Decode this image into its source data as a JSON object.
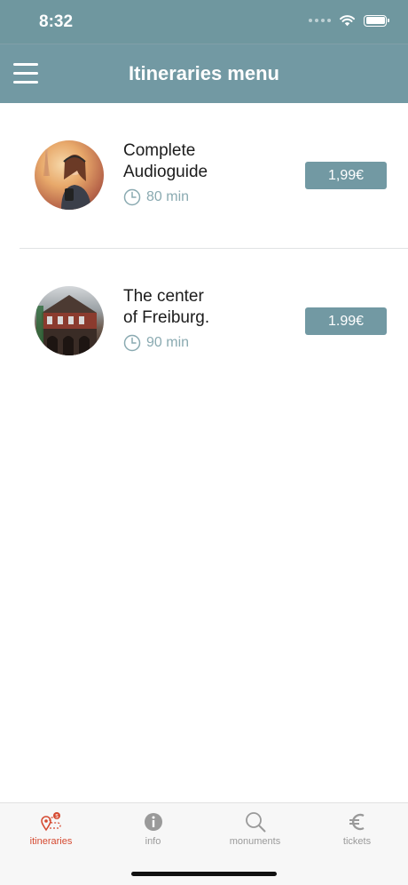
{
  "status_bar": {
    "time": "8:32"
  },
  "header": {
    "title": "Itineraries menu",
    "menu_icon": "hamburger-icon"
  },
  "itineraries": [
    {
      "title": "Complete\nAudioguide",
      "duration": "80 min",
      "price": "1,99€"
    },
    {
      "title": "The center\nof Freiburg.",
      "duration": "90 min",
      "price": "1.99€"
    }
  ],
  "tabs": [
    {
      "label": "itineraries",
      "icon": "route-pin-icon",
      "active": true
    },
    {
      "label": "info",
      "icon": "info-icon",
      "active": false
    },
    {
      "label": "monuments",
      "icon": "search-icon",
      "active": false
    },
    {
      "label": "tickets",
      "icon": "euro-icon",
      "active": false
    }
  ],
  "colors": {
    "primary": "#7299a3",
    "accent": "#d54a31",
    "inactive": "#9a9a9a",
    "duration": "#8aaab1"
  }
}
